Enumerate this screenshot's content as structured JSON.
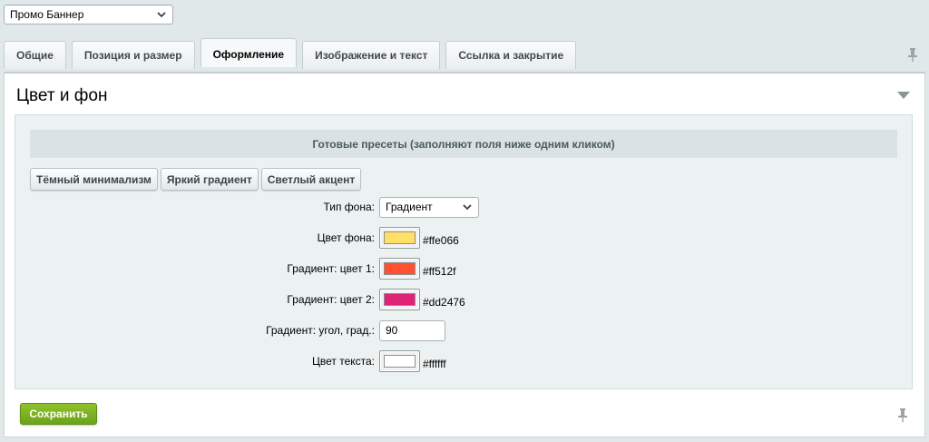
{
  "banner_select": {
    "value": "Промо Баннер",
    "icon": "chevron-down-icon"
  },
  "tabs": [
    {
      "label": "Общие",
      "active": false
    },
    {
      "label": "Позиция и размер",
      "active": false
    },
    {
      "label": "Оформление",
      "active": true
    },
    {
      "label": "Изображение и текст",
      "active": false
    },
    {
      "label": "Ссылка и закрытие",
      "active": false
    }
  ],
  "section": {
    "title": "Цвет и фон"
  },
  "presets": {
    "header": "Готовые пресеты (заполняют поля ниже одним кликом)",
    "buttons": [
      "Тёмный минимализм",
      "Яркий градиент",
      "Светлый акцент"
    ]
  },
  "form": {
    "bg_type": {
      "label": "Тип фона:",
      "value": "Градиент"
    },
    "bg_color": {
      "label": "Цвет фона:",
      "hex": "#ffe066"
    },
    "gradient_color_1": {
      "label": "Градиент: цвет 1:",
      "hex": "#ff512f"
    },
    "gradient_color_2": {
      "label": "Градиент: цвет 2:",
      "hex": "#dd2476"
    },
    "gradient_angle": {
      "label": "Градиент: угол, град.:",
      "value": "90"
    },
    "text_color": {
      "label": "Цвет текста:",
      "hex": "#ffffff"
    }
  },
  "actions": {
    "save_label": "Сохранить"
  },
  "colors": {
    "accent_green": "#7cb223",
    "panel_bg": "#ecf1f2"
  }
}
